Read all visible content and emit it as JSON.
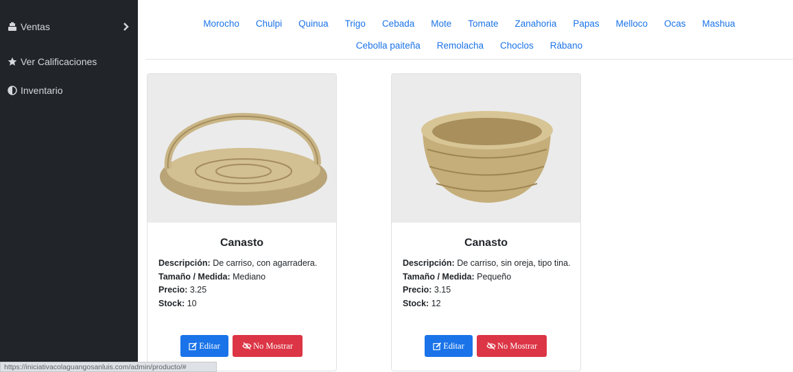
{
  "sidebar": {
    "items": [
      {
        "label": "Ventas",
        "icon": "cash-register-icon",
        "has_chevron": true
      },
      {
        "label": "Ver Calificaciones",
        "icon": "star-icon"
      },
      {
        "label": "Inventario",
        "icon": "half-circle-icon"
      }
    ]
  },
  "topnav": {
    "row1": [
      "Morocho",
      "Chulpi",
      "Quinua",
      "Trigo",
      "Cebada",
      "Mote",
      "Tomate",
      "Zanahoria",
      "Papas",
      "Melloco",
      "Ocas",
      "Mashua"
    ],
    "row2": [
      "Cebolla paiteña",
      "Remolacha",
      "Choclos",
      "Rábano"
    ]
  },
  "cards": [
    {
      "title": "Canasto",
      "desc_label": "Descripción:",
      "desc": "De carriso, con agarradera.",
      "size_label": "Tamaño / Medida:",
      "size": "Mediano",
      "price_label": "Precio:",
      "price": "3.25",
      "stock_label": "Stock:",
      "stock": "10",
      "edit_label": "Editar",
      "hide_label": "No Mostrar"
    },
    {
      "title": "Canasto",
      "desc_label": "Descripción:",
      "desc": "De carriso, sin oreja, tipo tina.",
      "size_label": "Tamaño / Medida:",
      "size": "Pequeño",
      "price_label": "Precio:",
      "price": "3.15",
      "stock_label": "Stock:",
      "stock": "12",
      "edit_label": "Editar",
      "hide_label": "No Mostrar"
    }
  ],
  "status_url": "https://iniciativacolaguangosanluis.com/admin/producto/#",
  "colors": {
    "sidebar_bg": "#212529",
    "link": "#1a73e8",
    "edit_btn": "#1a73e8",
    "hide_btn": "#dc3545"
  }
}
